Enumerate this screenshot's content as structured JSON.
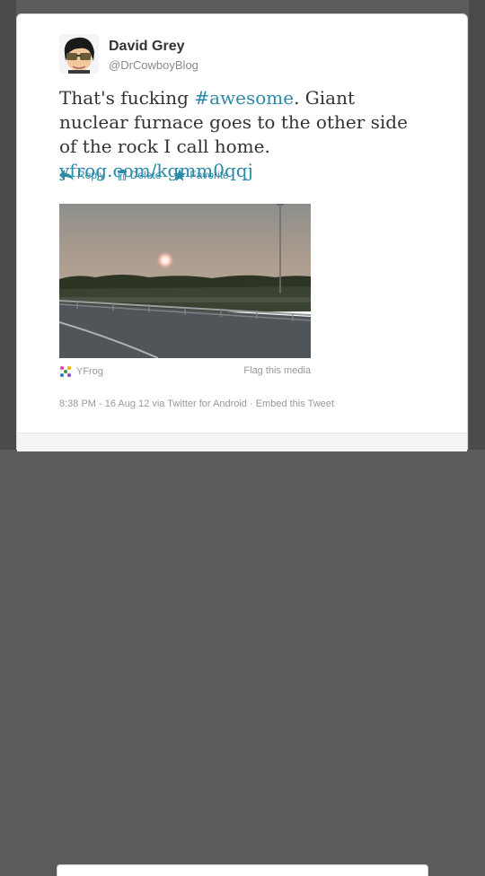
{
  "tweet": {
    "author_name": "David Grey",
    "handle": "@DrCowboyBlog",
    "text_part1": "That's fucking ",
    "hashtag": "#awesome",
    "text_part2": ". Giant nuclear furnace goes to the other side of the rock I call home. ",
    "link": "yfrog.com/kgmm0qqj"
  },
  "actions": {
    "reply": "Reply",
    "delete": "Delete",
    "favorite": "Favorite"
  },
  "media": {
    "provider": "YFrog",
    "flag_label": "Flag this media"
  },
  "meta": {
    "timestamp": "8:38 PM - 16 Aug 12 via Twitter for Android",
    "separator": " · ",
    "embed_label": "Embed this Tweet"
  },
  "icons": {
    "reply": "reply-arrow-icon",
    "delete": "trash-icon",
    "favorite": "star-icon",
    "provider": "yfrog-logo-icon"
  },
  "colors": {
    "link": "#2a8aa8",
    "frame": "#4a4a4a"
  }
}
